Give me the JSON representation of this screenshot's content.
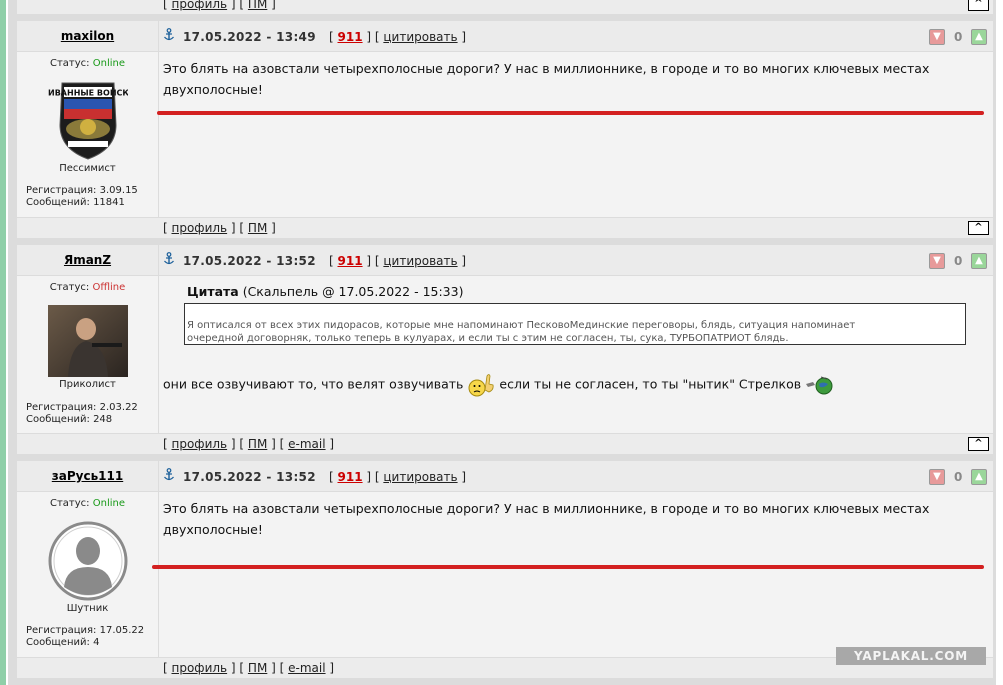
{
  "footer_links": {
    "profile": "профиль",
    "pm": "ПМ",
    "email": "e-mail"
  },
  "up_button": "^",
  "posts": [
    {
      "username": "maxilon",
      "status_label": "Статус:",
      "status_value": "Online",
      "avatar_text": "ДИВАННЫЕ ВОЙСКА",
      "rank": "Пессимист",
      "reg_label": "Регистрация:",
      "reg_date": "3.09.15",
      "msgs_label": "Сообщений:",
      "msgs_count": "11841",
      "date": "17.05.2022 - 13:49",
      "post_number": "911",
      "quote_action": "цитировать",
      "rating": "0",
      "text_line1": "Это блять на азовстали четырехполосные дороги? У нас в миллионнике, в городе и то во многих ключевых местах",
      "text_line2": "двухполосные!"
    },
    {
      "username": "ЯmanZ",
      "status_label": "Статус:",
      "status_value": "Offline",
      "rank": "Приколист",
      "reg_label": "Регистрация:",
      "reg_date": "2.03.22",
      "msgs_label": "Сообщений:",
      "msgs_count": "248",
      "date": "17.05.2022 - 13:52",
      "post_number": "911",
      "quote_action": "цитировать",
      "rating": "0",
      "quote_title": "Цитата",
      "quote_meta": "(Скальпель @ 17.05.2022 - 15:33)",
      "quote_line1": "Я оптисался от всех этих пидорасов, которые мне напоминают ПесковоМединские переговоры, блядь, ситуация напоминает",
      "quote_line2": "очередной договорняк, только теперь в кулуарах, и если ты с этим не согласен, ты, сука, ТУРБОПАТРИОТ блядь.",
      "text_part1": "они все озвучивают то, что велят озвучивать",
      "text_part2": "если ты не согласен, то ты \"нытик\" Стрелков"
    },
    {
      "username": "заРусь111",
      "status_label": "Статус:",
      "status_value": "Online",
      "rank": "Шутник",
      "reg_label": "Регистрация:",
      "reg_date": "17.05.22",
      "msgs_label": "Сообщений:",
      "msgs_count": "4",
      "date": "17.05.2022 - 13:52",
      "post_number": "911",
      "quote_action": "цитировать",
      "rating": "0",
      "text_line1": "Это блять на азовстали четырехполосные дороги? У нас в миллионнике, в городе и то во многих ключевых местах",
      "text_line2": "двухполосные!"
    }
  ],
  "watermark": "YAPLAKAL.COM",
  "colors": {
    "accent_red": "#d32020",
    "online": "#1a9a1a",
    "offline": "#cc3333",
    "post_number": "#cc0000"
  }
}
